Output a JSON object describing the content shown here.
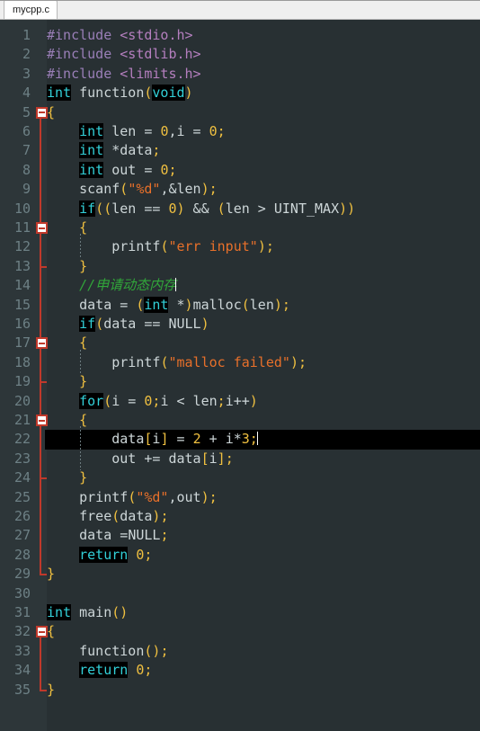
{
  "window": {
    "tab_label": "mycpp.c"
  },
  "editor": {
    "language": "c",
    "current_line": 22,
    "first_line": 1,
    "last_line": 35,
    "colors": {
      "background": "#283033",
      "gutter": "#2d3639",
      "line_number": "#6d8085",
      "text": "#cdd6d8",
      "keyword": "#32d0d8",
      "keyword_bg": "#000000",
      "preprocessor": "#9a7fb8",
      "header": "#b57fbf",
      "string": "#e8702a",
      "number": "#f0c040",
      "punctuation": "#f0c040",
      "comment": "#31a63a",
      "fold_marker": "#c0392b",
      "current_line_bg": "#000000"
    },
    "lines": [
      {
        "n": 1,
        "text": "#include <stdio.h>"
      },
      {
        "n": 2,
        "text": "#include <stdlib.h>"
      },
      {
        "n": 3,
        "text": "#include <limits.h>"
      },
      {
        "n": 4,
        "text": "int function(void)"
      },
      {
        "n": 5,
        "text": "{",
        "fold": "open"
      },
      {
        "n": 6,
        "text": "    int len = 0,i = 0;"
      },
      {
        "n": 7,
        "text": "    int *data;"
      },
      {
        "n": 8,
        "text": "    int out = 0;"
      },
      {
        "n": 9,
        "text": "    scanf(\"%d\",&len);"
      },
      {
        "n": 10,
        "text": "    if((len == 0) && (len > UINT_MAX))"
      },
      {
        "n": 11,
        "text": "    {",
        "fold": "open"
      },
      {
        "n": 12,
        "text": "        printf(\"err input\");"
      },
      {
        "n": 13,
        "text": "    }",
        "fold": "end"
      },
      {
        "n": 14,
        "text": "    //申请动态内存"
      },
      {
        "n": 15,
        "text": "    data = (int *)malloc(len);"
      },
      {
        "n": 16,
        "text": "    if(data == NULL)"
      },
      {
        "n": 17,
        "text": "    {",
        "fold": "open"
      },
      {
        "n": 18,
        "text": "        printf(\"malloc failed\");"
      },
      {
        "n": 19,
        "text": "    }",
        "fold": "end"
      },
      {
        "n": 20,
        "text": "    for(i = 0;i < len;i++)"
      },
      {
        "n": 21,
        "text": "    {",
        "fold": "open"
      },
      {
        "n": 22,
        "text": "        data[i] = 2 + i*3;",
        "current": true
      },
      {
        "n": 23,
        "text": "        out += data[i];"
      },
      {
        "n": 24,
        "text": "    }",
        "fold": "end"
      },
      {
        "n": 25,
        "text": "    printf(\"%d\",out);"
      },
      {
        "n": 26,
        "text": "    free(data);"
      },
      {
        "n": 27,
        "text": "    data =NULL;"
      },
      {
        "n": 28,
        "text": "    return 0;"
      },
      {
        "n": 29,
        "text": "}",
        "fold": "end"
      },
      {
        "n": 30,
        "text": ""
      },
      {
        "n": 31,
        "text": "int main()"
      },
      {
        "n": 32,
        "text": "{",
        "fold": "open"
      },
      {
        "n": 33,
        "text": "    function();"
      },
      {
        "n": 34,
        "text": "    return 0;"
      },
      {
        "n": 35,
        "text": "}",
        "fold": "end"
      }
    ]
  }
}
